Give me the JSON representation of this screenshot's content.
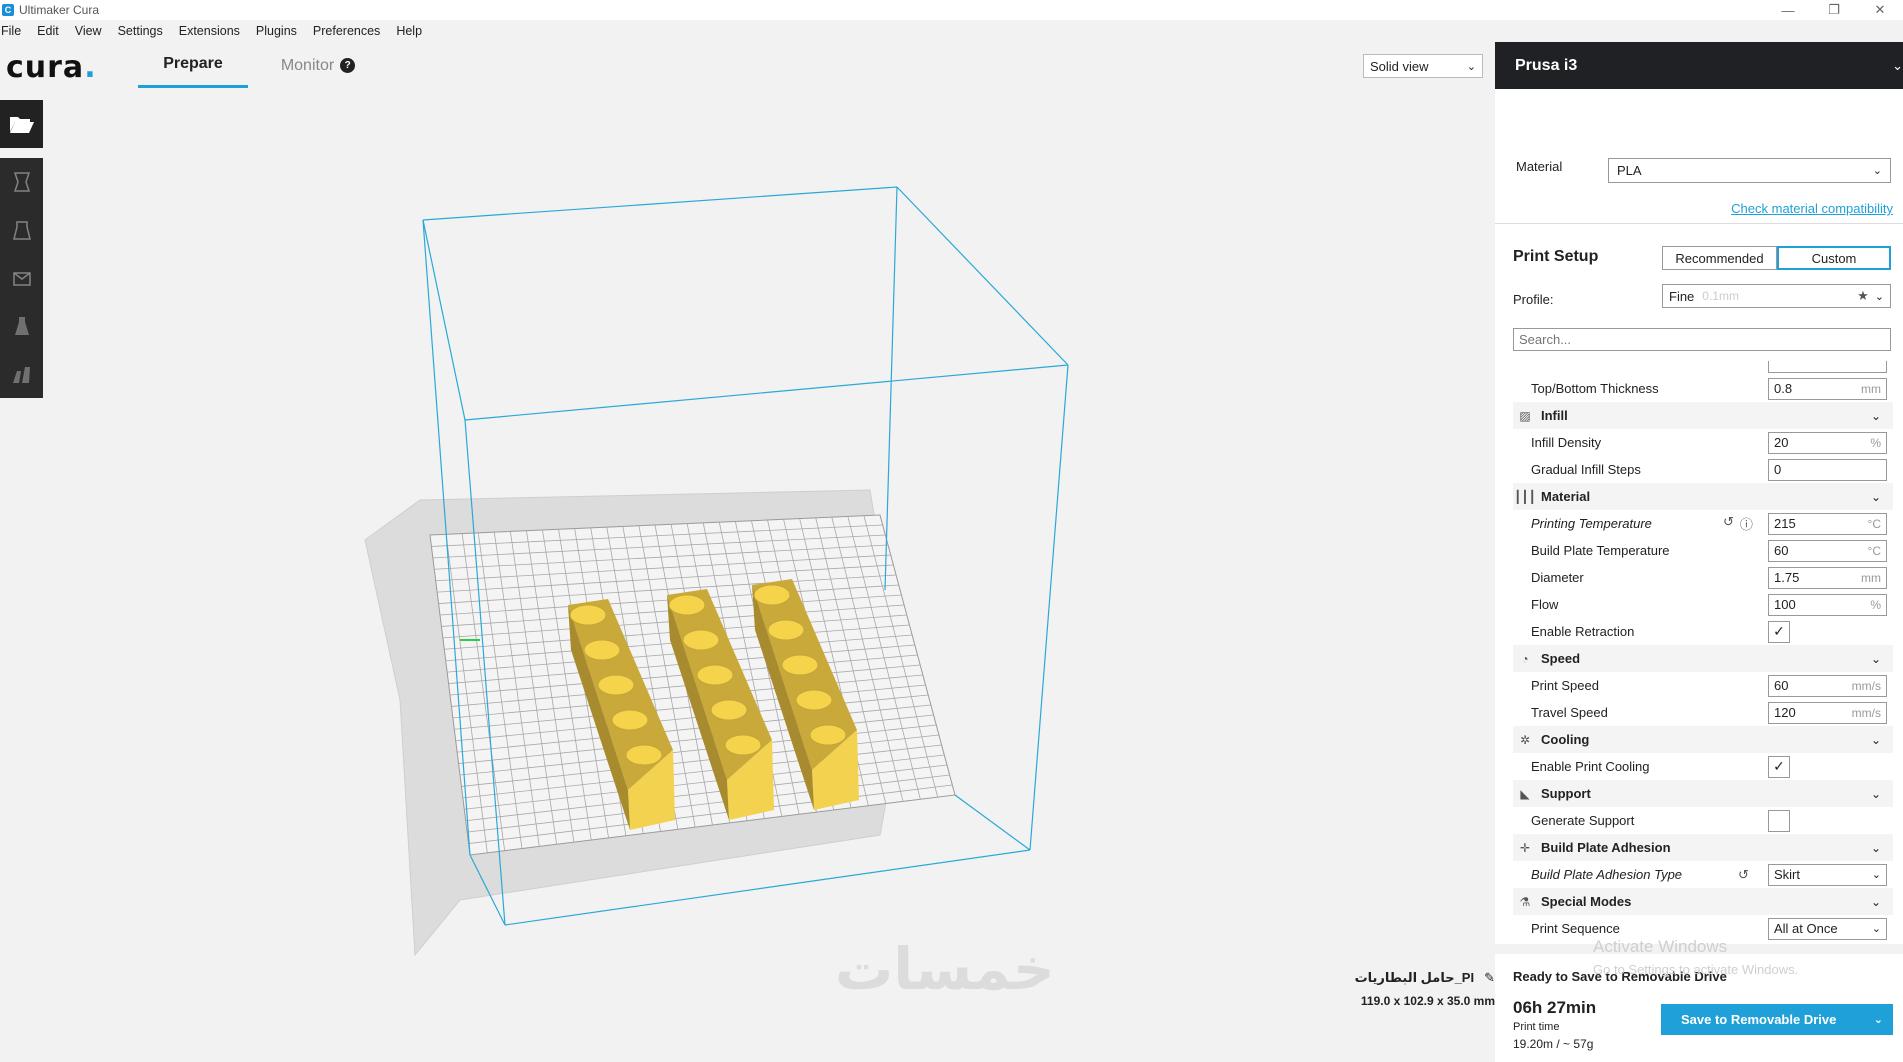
{
  "window": {
    "title": "Ultimaker Cura",
    "app_icon": "C",
    "controls": [
      "—",
      "❐",
      "✕"
    ]
  },
  "menu": [
    "File",
    "Edit",
    "View",
    "Settings",
    "Extensions",
    "Plugins",
    "Preferences",
    "Help"
  ],
  "header": {
    "logo": "cura",
    "logo_dot": ".",
    "tabs": {
      "prepare": "Prepare",
      "monitor": "Monitor",
      "monitor_help": "?"
    },
    "view_mode": "Solid view"
  },
  "left_tools": [
    "folder-open-icon",
    "translate-icon",
    "scale-icon",
    "rotate-icon",
    "mirror-icon",
    "per-model-settings-icon"
  ],
  "viewport": {
    "object_name": "حامل البطاريات_PI",
    "object_dims": "119.0 x 102.9 x 35.0 mm",
    "watermark": "خمسات"
  },
  "panel": {
    "printer": "Prusa i3",
    "material_label": "Material",
    "material_value": "PLA",
    "material_link": "Check material compatibility",
    "print_setup_title": "Print Setup",
    "mode_recommended": "Recommended",
    "mode_custom": "Custom",
    "profile_label": "Profile:",
    "profile_value": "Fine",
    "profile_sub": "0.1mm",
    "search_placeholder": "Search..."
  },
  "settings": [
    {
      "kind": "row",
      "label": "Top/Bottom Thickness",
      "value": "0.8",
      "unit": "mm"
    },
    {
      "kind": "cat",
      "label": "Infill",
      "icon": "infill-icon",
      "glyph": "▨"
    },
    {
      "kind": "row",
      "label": "Infill Density",
      "value": "20",
      "unit": "%"
    },
    {
      "kind": "row",
      "label": "Gradual Infill Steps",
      "value": "0",
      "unit": ""
    },
    {
      "kind": "cat",
      "label": "Material",
      "icon": "material-icon",
      "glyph": "┃┃┃"
    },
    {
      "kind": "row",
      "label": "Printing Temperature",
      "value": "215",
      "unit": "°C",
      "italic": true,
      "extra": true
    },
    {
      "kind": "row",
      "label": "Build Plate Temperature",
      "value": "60",
      "unit": "°C"
    },
    {
      "kind": "row",
      "label": "Diameter",
      "value": "1.75",
      "unit": "mm"
    },
    {
      "kind": "row",
      "label": "Flow",
      "value": "100",
      "unit": "%"
    },
    {
      "kind": "check",
      "label": "Enable Retraction",
      "checked": true
    },
    {
      "kind": "cat",
      "label": "Speed",
      "icon": "speed-icon",
      "glyph": "◔"
    },
    {
      "kind": "row",
      "label": "Print Speed",
      "value": "60",
      "unit": "mm/s"
    },
    {
      "kind": "row",
      "label": "Travel Speed",
      "value": "120",
      "unit": "mm/s"
    },
    {
      "kind": "cat",
      "label": "Cooling",
      "icon": "cooling-icon",
      "glyph": "✲"
    },
    {
      "kind": "check",
      "label": "Enable Print Cooling",
      "checked": true
    },
    {
      "kind": "cat",
      "label": "Support",
      "icon": "support-icon",
      "glyph": "◣"
    },
    {
      "kind": "check",
      "label": "Generate Support",
      "checked": false
    },
    {
      "kind": "cat",
      "label": "Build Plate Adhesion",
      "icon": "adhesion-icon",
      "glyph": "✛"
    },
    {
      "kind": "select",
      "label": "Build Plate Adhesion Type",
      "value": "Skirt",
      "italic": true,
      "reset": true
    },
    {
      "kind": "cat",
      "label": "Special Modes",
      "icon": "special-modes-icon",
      "glyph": "⚗"
    },
    {
      "kind": "select",
      "label": "Print Sequence",
      "value": "All at Once"
    }
  ],
  "save": {
    "ready": "Ready to Save to Removable Drive",
    "time": "06h 27min",
    "time_label": "Print time",
    "usage": "19.20m / ~ 57g",
    "button": "Save to Removable Drive"
  },
  "os_overlay": {
    "line1": "Activate Windows",
    "line2": "Go to Settings to activate Windows."
  },
  "colors": {
    "accent": "#1fa0d9",
    "model": "#f5d34a",
    "dark": "#202124"
  }
}
